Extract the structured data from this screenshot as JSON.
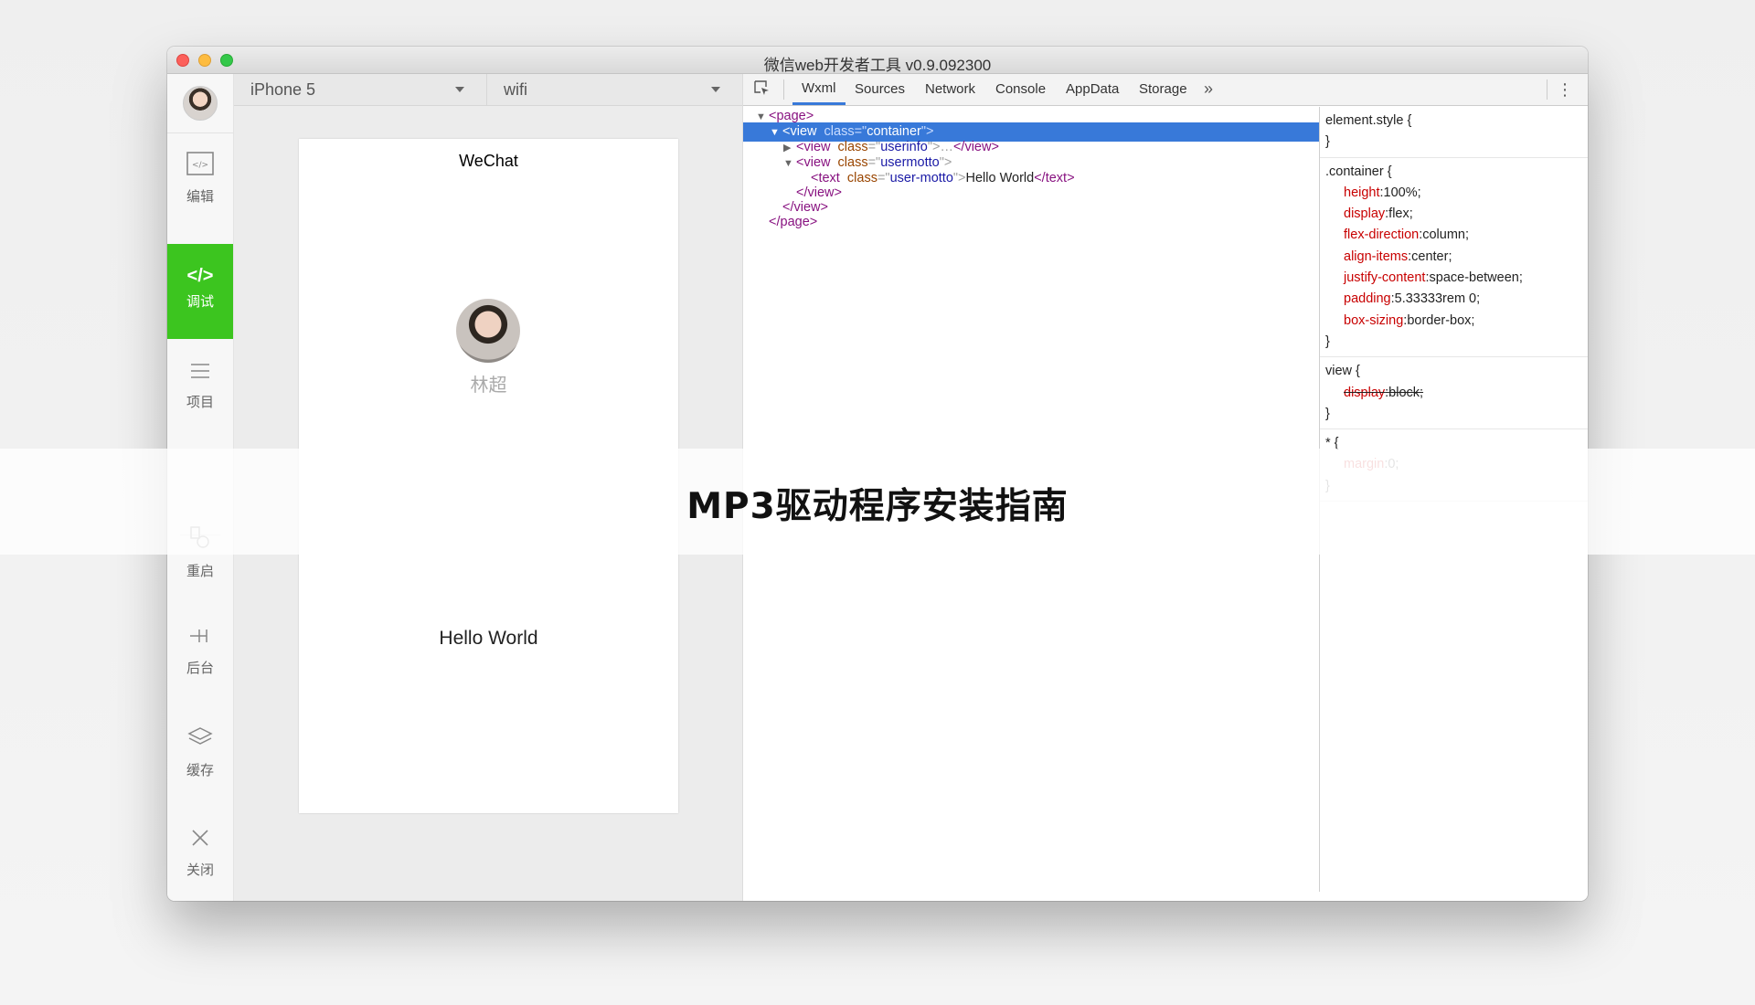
{
  "window": {
    "title": "微信web开发者工具 v0.9.092300"
  },
  "sidebar": {
    "items": [
      {
        "label": "编辑",
        "icon": "code-editor-icon"
      },
      {
        "label": "调试",
        "icon": "debug-code-icon"
      },
      {
        "label": "项目",
        "icon": "menu-lines-icon"
      },
      {
        "label": "重启",
        "icon": "restart-icon"
      },
      {
        "label": "后台",
        "icon": "background-icon"
      },
      {
        "label": "缓存",
        "icon": "layers-icon"
      },
      {
        "label": "关闭",
        "icon": "close-icon"
      }
    ],
    "active_color": "#3cc51f"
  },
  "simulator": {
    "device": "iPhone 5",
    "network": "wifi",
    "nav_title": "WeChat",
    "nickname": "林超",
    "motto": "Hello World"
  },
  "devtools": {
    "tabs": [
      "Wxml",
      "Sources",
      "Network",
      "Console",
      "AppData",
      "Storage"
    ],
    "active_tab": "Wxml",
    "tree": {
      "page_open": "page",
      "view": "view",
      "class_attr": "class",
      "container": "container",
      "userinfo": "userinfo",
      "ellipsis": "…",
      "usermotto": "usermotto",
      "text_tag": "text",
      "user_motto": "user-motto",
      "hello": "Hello World"
    },
    "styles": {
      "element_style": "element.style {",
      "container_selector": ".container {",
      "container_decls": [
        {
          "prop": "height",
          "value": "100%;"
        },
        {
          "prop": "display",
          "value": "flex;"
        },
        {
          "prop": "flex-direction",
          "value": "column;"
        },
        {
          "prop": "align-items",
          "value": "center;"
        },
        {
          "prop": "justify-content",
          "value": "space-between;"
        },
        {
          "prop": "padding",
          "value": "5.33333rem 0;"
        },
        {
          "prop": "box-sizing",
          "value": "border-box;"
        }
      ],
      "view_selector": "view {",
      "view_decl": {
        "prop": "display",
        "value": "block;"
      },
      "star_selector": "* {",
      "star_decl": {
        "prop": "margin",
        "value": "0;"
      },
      "close_brace": "}"
    },
    "selection_color": "#3879d9"
  },
  "banner": {
    "text": "MP3驱动程序安装指南"
  }
}
